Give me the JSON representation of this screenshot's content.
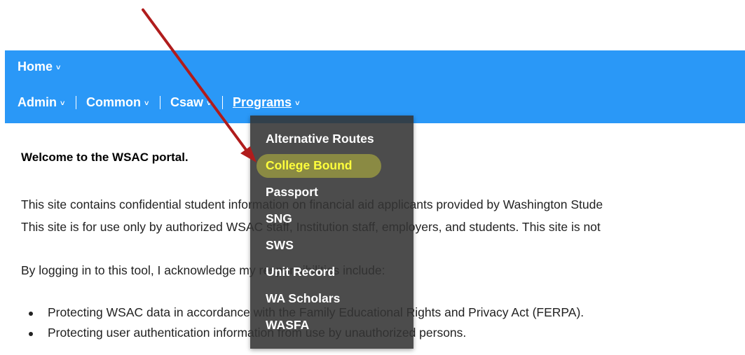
{
  "nav": {
    "row1": [
      {
        "label": "Home",
        "icon": "chevron-down-icon"
      }
    ],
    "row2": [
      {
        "label": "Admin",
        "icon": "chevron-down-icon"
      },
      {
        "label": "Common",
        "icon": "chevron-down-icon"
      },
      {
        "label": "Csaw",
        "icon": "chevron-down-icon"
      },
      {
        "label": "Programs",
        "icon": "chevron-down-icon",
        "active": true
      }
    ],
    "chevron_glyph": "˅"
  },
  "dropdown": {
    "items": [
      {
        "label": "Alternative Routes"
      },
      {
        "label": "College Bound",
        "highlighted": true
      },
      {
        "label": "Passport"
      },
      {
        "label": "SNG"
      },
      {
        "label": "SWS"
      },
      {
        "label": "Unit Record"
      },
      {
        "label": "WA Scholars"
      },
      {
        "label": "WASFA"
      }
    ]
  },
  "content": {
    "welcome": "Welcome to the WSAC portal.",
    "paragraph1": "This site contains confidential student information on financial aid applicants provided by Washington Stude",
    "paragraph2": "This site is for use only by authorized WSAC staff, Institution staff, employers, and students. This site is not",
    "paragraph3": "By logging in to this tool, I acknowledge my responsibilities include:",
    "bullets": [
      "Protecting WSAC data in accordance with the Family Educational Rights and Privacy Act (FERPA).",
      "Protecting user authentication information from use by unauthorized persons."
    ]
  },
  "colors": {
    "nav_background": "#2a98f7",
    "dropdown_background": "#333333",
    "highlight_text": "#ffff3c",
    "annotation_arrow": "#b01c1c"
  }
}
